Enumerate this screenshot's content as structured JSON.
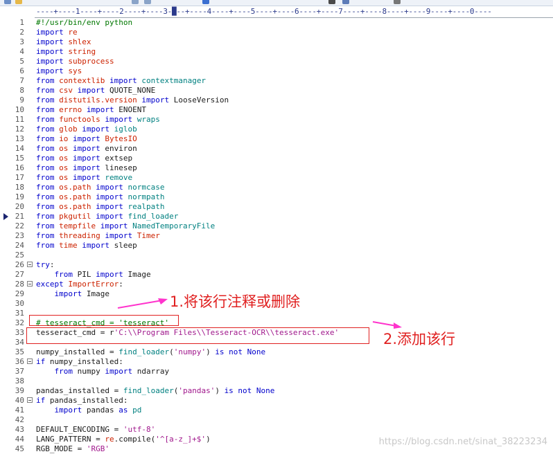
{
  "ruler": {
    "text": "----+----1----+----2----+----3-█--+----4----+----5----+----6----+----7----+----8----+----9----+----0----"
  },
  "lines": [
    {
      "n": "1",
      "fold": false,
      "parts": [
        {
          "t": "#!/usr/bin/env python",
          "c": "cmt"
        }
      ]
    },
    {
      "n": "2",
      "fold": false,
      "parts": [
        {
          "t": "import ",
          "c": "kw"
        },
        {
          "t": "re",
          "c": "mod"
        }
      ]
    },
    {
      "n": "3",
      "fold": false,
      "parts": [
        {
          "t": "import ",
          "c": "kw"
        },
        {
          "t": "shlex",
          "c": "mod"
        }
      ]
    },
    {
      "n": "4",
      "fold": false,
      "parts": [
        {
          "t": "import ",
          "c": "kw"
        },
        {
          "t": "string",
          "c": "mod"
        }
      ]
    },
    {
      "n": "5",
      "fold": false,
      "parts": [
        {
          "t": "import ",
          "c": "kw"
        },
        {
          "t": "subprocess",
          "c": "mod"
        }
      ]
    },
    {
      "n": "6",
      "fold": false,
      "parts": [
        {
          "t": "import ",
          "c": "kw"
        },
        {
          "t": "sys",
          "c": "mod"
        }
      ]
    },
    {
      "n": "7",
      "fold": false,
      "parts": [
        {
          "t": "from ",
          "c": "kw"
        },
        {
          "t": "contextlib",
          "c": "mod"
        },
        {
          "t": " import ",
          "c": "kw"
        },
        {
          "t": "contextmanager",
          "c": "nm"
        }
      ]
    },
    {
      "n": "8",
      "fold": false,
      "parts": [
        {
          "t": "from ",
          "c": "kw"
        },
        {
          "t": "csv",
          "c": "mod"
        },
        {
          "t": " import ",
          "c": "kw"
        },
        {
          "t": "QUOTE_NONE",
          "c": ""
        }
      ]
    },
    {
      "n": "9",
      "fold": false,
      "parts": [
        {
          "t": "from ",
          "c": "kw"
        },
        {
          "t": "distutils.version",
          "c": "mod"
        },
        {
          "t": " import ",
          "c": "kw"
        },
        {
          "t": "LooseVersion",
          "c": ""
        }
      ]
    },
    {
      "n": "10",
      "fold": false,
      "parts": [
        {
          "t": "from ",
          "c": "kw"
        },
        {
          "t": "errno",
          "c": "mod"
        },
        {
          "t": " import ",
          "c": "kw"
        },
        {
          "t": "ENOENT",
          "c": ""
        }
      ]
    },
    {
      "n": "11",
      "fold": false,
      "parts": [
        {
          "t": "from ",
          "c": "kw"
        },
        {
          "t": "functools",
          "c": "mod"
        },
        {
          "t": " import ",
          "c": "kw"
        },
        {
          "t": "wraps",
          "c": "nm"
        }
      ]
    },
    {
      "n": "12",
      "fold": false,
      "parts": [
        {
          "t": "from ",
          "c": "kw"
        },
        {
          "t": "glob",
          "c": "mod"
        },
        {
          "t": " import ",
          "c": "kw"
        },
        {
          "t": "iglob",
          "c": "nm"
        }
      ]
    },
    {
      "n": "13",
      "fold": false,
      "parts": [
        {
          "t": "from ",
          "c": "kw"
        },
        {
          "t": "io",
          "c": "mod"
        },
        {
          "t": " import ",
          "c": "kw"
        },
        {
          "t": "BytesIO",
          "c": "mod"
        }
      ]
    },
    {
      "n": "14",
      "fold": false,
      "parts": [
        {
          "t": "from ",
          "c": "kw"
        },
        {
          "t": "os",
          "c": "mod"
        },
        {
          "t": " import ",
          "c": "kw"
        },
        {
          "t": "environ",
          "c": ""
        }
      ]
    },
    {
      "n": "15",
      "fold": false,
      "parts": [
        {
          "t": "from ",
          "c": "kw"
        },
        {
          "t": "os",
          "c": "mod"
        },
        {
          "t": " import ",
          "c": "kw"
        },
        {
          "t": "extsep",
          "c": ""
        }
      ]
    },
    {
      "n": "16",
      "fold": false,
      "parts": [
        {
          "t": "from ",
          "c": "kw"
        },
        {
          "t": "os",
          "c": "mod"
        },
        {
          "t": " import ",
          "c": "kw"
        },
        {
          "t": "linesep",
          "c": ""
        }
      ]
    },
    {
      "n": "17",
      "fold": false,
      "parts": [
        {
          "t": "from ",
          "c": "kw"
        },
        {
          "t": "os",
          "c": "mod"
        },
        {
          "t": " import ",
          "c": "kw"
        },
        {
          "t": "remove",
          "c": "nm"
        }
      ]
    },
    {
      "n": "18",
      "fold": false,
      "parts": [
        {
          "t": "from ",
          "c": "kw"
        },
        {
          "t": "os.path",
          "c": "mod"
        },
        {
          "t": " import ",
          "c": "kw"
        },
        {
          "t": "normcase",
          "c": "nm"
        }
      ]
    },
    {
      "n": "19",
      "fold": false,
      "parts": [
        {
          "t": "from ",
          "c": "kw"
        },
        {
          "t": "os.path",
          "c": "mod"
        },
        {
          "t": " import ",
          "c": "kw"
        },
        {
          "t": "normpath",
          "c": "nm"
        }
      ]
    },
    {
      "n": "20",
      "fold": false,
      "parts": [
        {
          "t": "from ",
          "c": "kw"
        },
        {
          "t": "os.path",
          "c": "mod"
        },
        {
          "t": " import ",
          "c": "kw"
        },
        {
          "t": "realpath",
          "c": "nm"
        }
      ]
    },
    {
      "n": "21",
      "fold": false,
      "parts": [
        {
          "t": "from ",
          "c": "kw"
        },
        {
          "t": "pkgutil",
          "c": "mod"
        },
        {
          "t": " import ",
          "c": "kw"
        },
        {
          "t": "find_loader",
          "c": "nm"
        }
      ]
    },
    {
      "n": "22",
      "fold": false,
      "parts": [
        {
          "t": "from ",
          "c": "kw"
        },
        {
          "t": "tempfile",
          "c": "mod"
        },
        {
          "t": " import ",
          "c": "kw"
        },
        {
          "t": "NamedTemporaryFile",
          "c": "nm"
        }
      ]
    },
    {
      "n": "23",
      "fold": false,
      "parts": [
        {
          "t": "from ",
          "c": "kw"
        },
        {
          "t": "threading",
          "c": "mod"
        },
        {
          "t": " import ",
          "c": "kw"
        },
        {
          "t": "Timer",
          "c": "mod"
        }
      ]
    },
    {
      "n": "24",
      "fold": false,
      "parts": [
        {
          "t": "from ",
          "c": "kw"
        },
        {
          "t": "time",
          "c": "mod"
        },
        {
          "t": " import ",
          "c": "kw"
        },
        {
          "t": "sleep",
          "c": ""
        }
      ]
    },
    {
      "n": "25",
      "fold": false,
      "parts": []
    },
    {
      "n": "26",
      "fold": true,
      "parts": [
        {
          "t": "try",
          "c": "kw"
        },
        {
          "t": ":",
          "c": ""
        }
      ]
    },
    {
      "n": "27",
      "fold": false,
      "parts": [
        {
          "t": "    from ",
          "c": "kw"
        },
        {
          "t": "PIL",
          "c": ""
        },
        {
          "t": " import ",
          "c": "kw"
        },
        {
          "t": "Image",
          "c": ""
        }
      ]
    },
    {
      "n": "28",
      "fold": true,
      "parts": [
        {
          "t": "except ",
          "c": "kw"
        },
        {
          "t": "ImportError",
          "c": "mod"
        },
        {
          "t": ":",
          "c": ""
        }
      ]
    },
    {
      "n": "29",
      "fold": false,
      "parts": [
        {
          "t": "    import ",
          "c": "kw"
        },
        {
          "t": "Image",
          "c": ""
        }
      ]
    },
    {
      "n": "30",
      "fold": false,
      "parts": []
    },
    {
      "n": "31",
      "fold": false,
      "parts": []
    },
    {
      "n": "32",
      "fold": false,
      "parts": [
        {
          "t": "# tesseract_cmd = 'tesseract'",
          "c": "cmt"
        }
      ]
    },
    {
      "n": "33",
      "fold": false,
      "parts": [
        {
          "t": "tesseract_cmd = r",
          "c": ""
        },
        {
          "t": "'C:\\\\Program Files\\\\Tesseract-OCR\\\\tesseract.exe'",
          "c": "str"
        }
      ]
    },
    {
      "n": "34",
      "fold": false,
      "parts": []
    },
    {
      "n": "35",
      "fold": false,
      "parts": [
        {
          "t": "numpy_installed = ",
          "c": ""
        },
        {
          "t": "find_loader",
          "c": "nm"
        },
        {
          "t": "(",
          "c": ""
        },
        {
          "t": "'numpy'",
          "c": "str"
        },
        {
          "t": ") ",
          "c": ""
        },
        {
          "t": "is not None",
          "c": "kw"
        }
      ]
    },
    {
      "n": "36",
      "fold": true,
      "parts": [
        {
          "t": "if ",
          "c": "kw"
        },
        {
          "t": "numpy_installed:",
          "c": ""
        }
      ]
    },
    {
      "n": "37",
      "fold": false,
      "parts": [
        {
          "t": "    from ",
          "c": "kw"
        },
        {
          "t": "numpy",
          "c": ""
        },
        {
          "t": " import ",
          "c": "kw"
        },
        {
          "t": "ndarray",
          "c": ""
        }
      ]
    },
    {
      "n": "38",
      "fold": false,
      "parts": []
    },
    {
      "n": "39",
      "fold": false,
      "parts": [
        {
          "t": "pandas_installed = ",
          "c": ""
        },
        {
          "t": "find_loader",
          "c": "nm"
        },
        {
          "t": "(",
          "c": ""
        },
        {
          "t": "'pandas'",
          "c": "str"
        },
        {
          "t": ") ",
          "c": ""
        },
        {
          "t": "is not None",
          "c": "kw"
        }
      ]
    },
    {
      "n": "40",
      "fold": true,
      "parts": [
        {
          "t": "if ",
          "c": "kw"
        },
        {
          "t": "pandas_installed:",
          "c": ""
        }
      ]
    },
    {
      "n": "41",
      "fold": false,
      "parts": [
        {
          "t": "    import ",
          "c": "kw"
        },
        {
          "t": "pandas ",
          "c": ""
        },
        {
          "t": "as ",
          "c": "kw"
        },
        {
          "t": "pd",
          "c": "nm"
        }
      ]
    },
    {
      "n": "42",
      "fold": false,
      "parts": []
    },
    {
      "n": "43",
      "fold": false,
      "parts": [
        {
          "t": "DEFAULT_ENCODING = ",
          "c": ""
        },
        {
          "t": "'utf-8'",
          "c": "str"
        }
      ]
    },
    {
      "n": "44",
      "fold": false,
      "parts": [
        {
          "t": "LANG_PATTERN = ",
          "c": ""
        },
        {
          "t": "re",
          "c": "mod"
        },
        {
          "t": ".compile(",
          "c": ""
        },
        {
          "t": "'^[a-z_]+$'",
          "c": "str"
        },
        {
          "t": ")",
          "c": ""
        }
      ]
    },
    {
      "n": "45",
      "fold": false,
      "parts": [
        {
          "t": "RGB_MODE = ",
          "c": ""
        },
        {
          "t": "'RGB'",
          "c": "str"
        }
      ]
    }
  ],
  "annotations": {
    "note1": "1.将该行注释或删除",
    "note2": "2.添加该行"
  },
  "watermark": "https://blog.csdn.net/sinat_38223234",
  "colors": {
    "annotation": "#e02020",
    "arrow": "#ff33cc",
    "keyword": "#0000cc"
  }
}
